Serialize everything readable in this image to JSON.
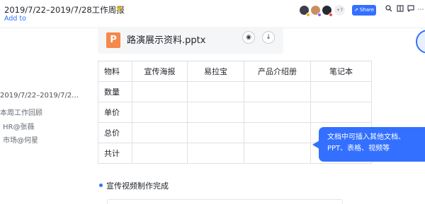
{
  "header": {
    "title": "2019/7/22–2019/7/28工作周报",
    "add_to": "Add to",
    "more_count": "+7",
    "share_label": "Share",
    "icons": [
      "search-icon",
      "history-icon",
      "comment-icon",
      "more-icon"
    ],
    "colors": {
      "accent": "#3370ff",
      "star": "#f5b400"
    }
  },
  "outline": {
    "date": "2019/7/22–2019/7/2…",
    "items": [
      "本周工作回顾",
      "HR@张薇",
      "市场@何星"
    ]
  },
  "attachment": {
    "name": "路演展示资料.pptx",
    "icon_letter": "P"
  },
  "table": {
    "headers": [
      "物料",
      "宣传海报",
      "易拉宝",
      "产品介绍册",
      "笔记本"
    ],
    "rows": [
      [
        "数量",
        "",
        "",
        "",
        ""
      ],
      [
        "单价",
        "",
        "",
        "",
        ""
      ],
      [
        "总价",
        "",
        "",
        "",
        ""
      ],
      [
        "共计",
        "",
        "",
        "",
        ""
      ]
    ]
  },
  "tooltip": {
    "line1": "文档中可插入其他文档、",
    "line2": "PPT、表格、视频等"
  },
  "bullet": {
    "text": "宣传视频制作完成"
  }
}
